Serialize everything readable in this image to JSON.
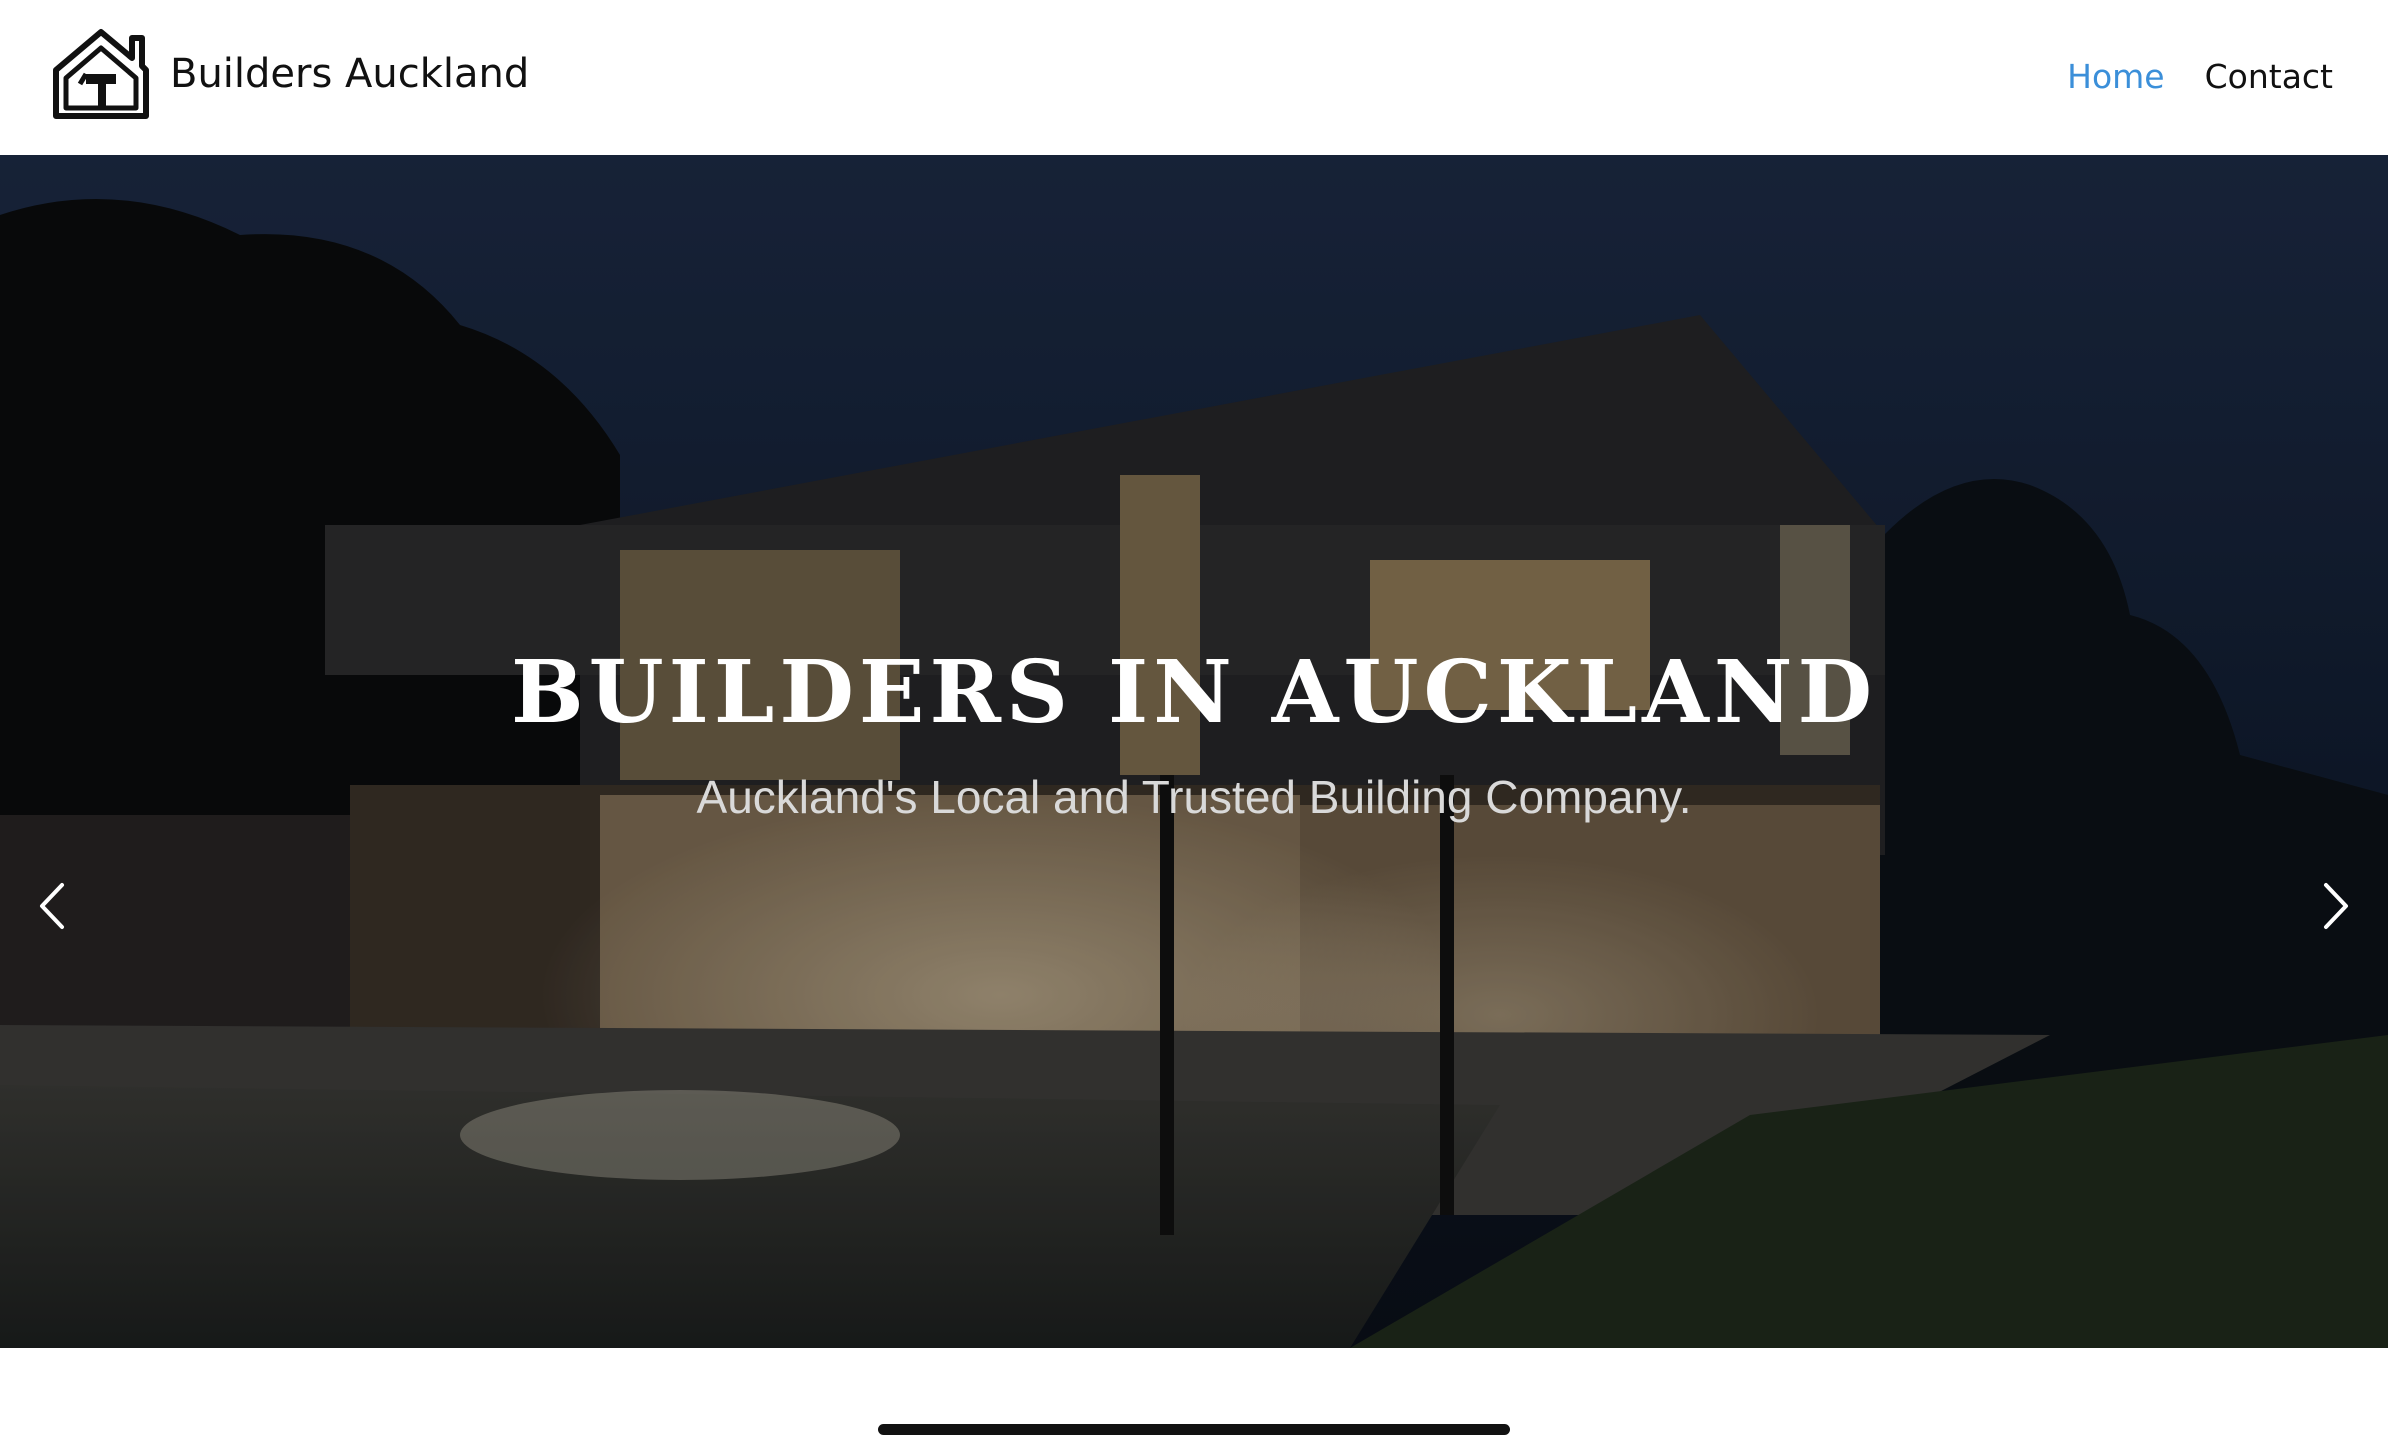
{
  "header": {
    "brand": "Builders Auckland",
    "logo_icon": "house-hammer-icon",
    "nav": [
      {
        "label": "Home",
        "active": true
      },
      {
        "label": "Contact",
        "active": false
      }
    ],
    "active_color": "#3b8fd9"
  },
  "hero": {
    "title": "BUILDERS IN AUCKLAND",
    "subtitle": "Auckland's Local and Trusted Building Company.",
    "prev_icon": "chevron-left-icon",
    "next_icon": "chevron-right-icon",
    "slides": 3,
    "active_slide": 1
  }
}
